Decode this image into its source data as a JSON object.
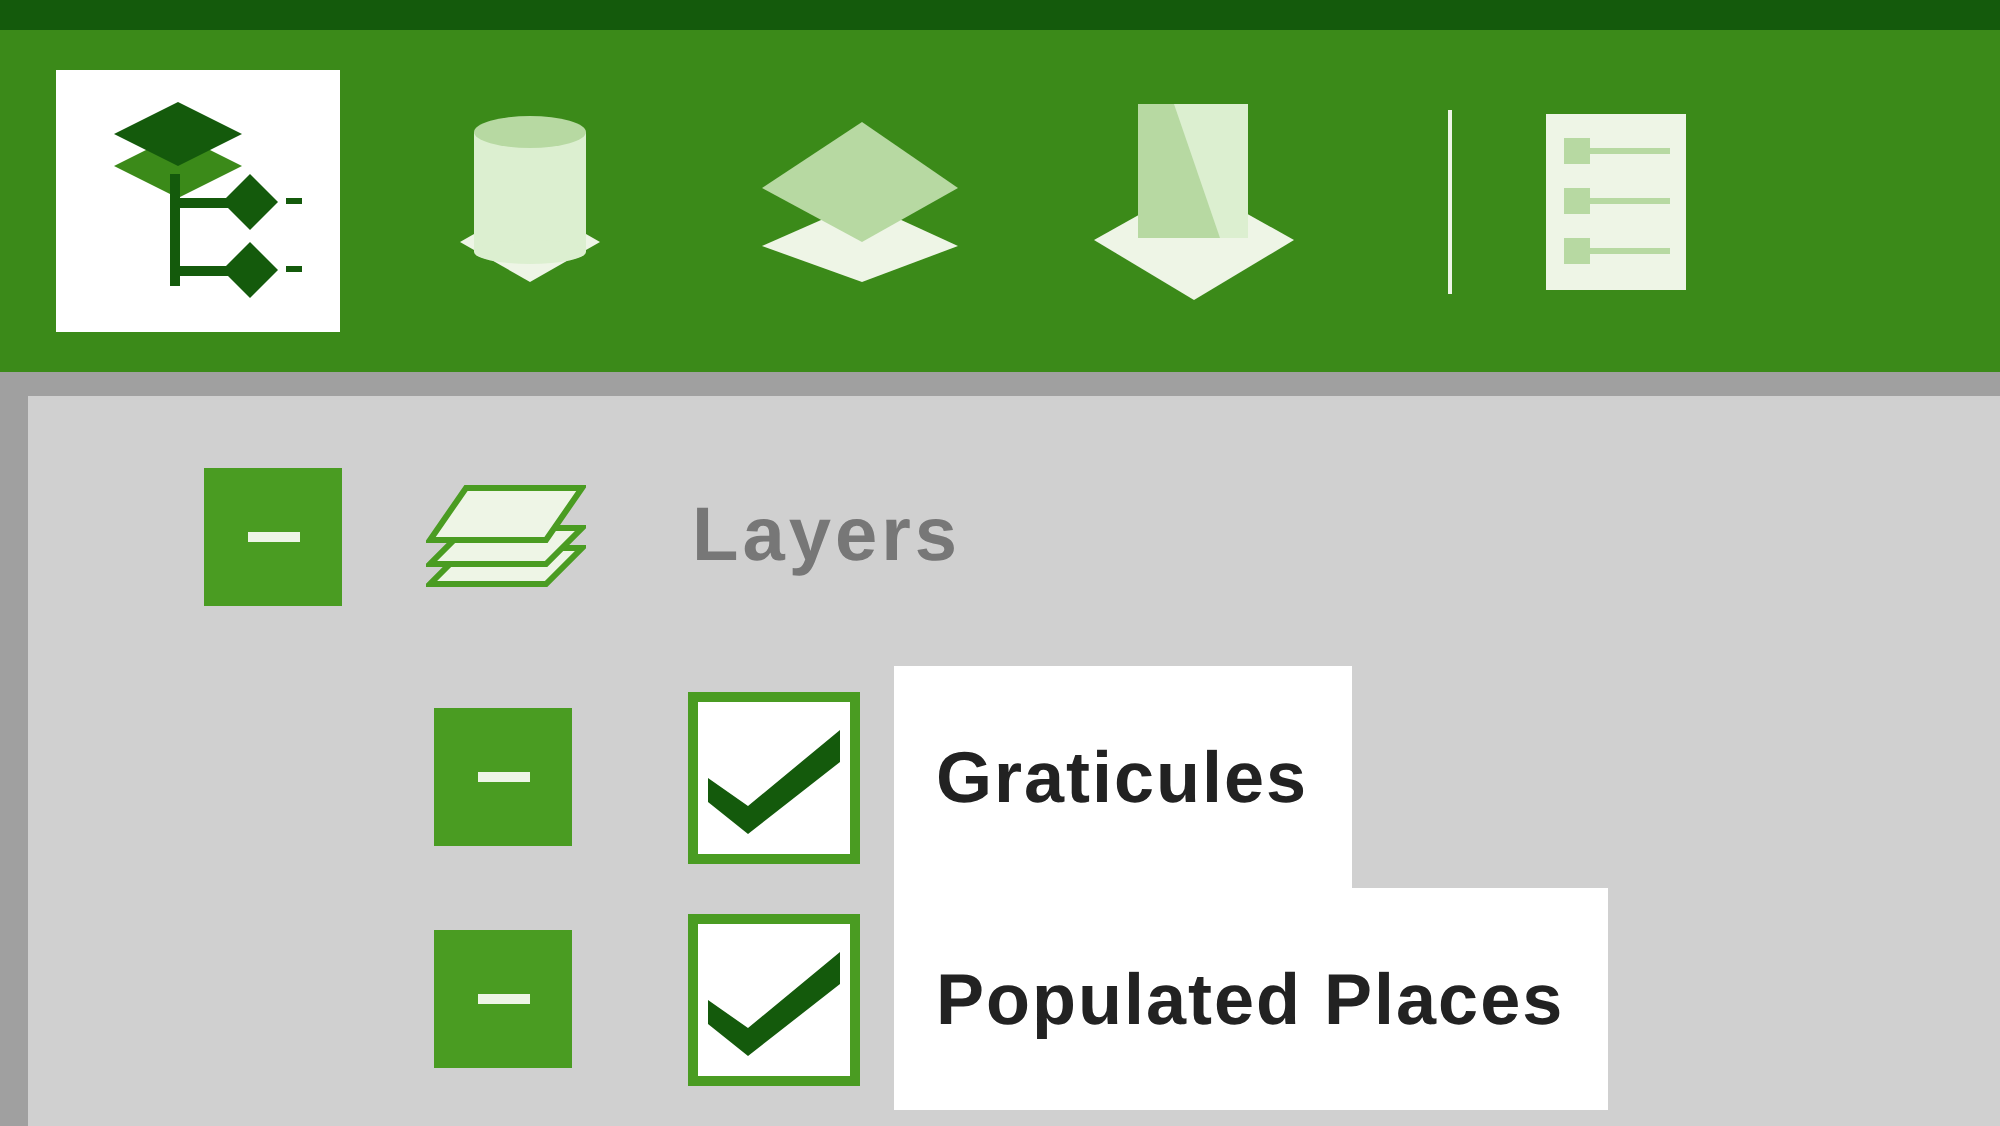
{
  "toolbar": {
    "groups": [
      [
        {
          "kind": "tree",
          "selected": true
        },
        {
          "kind": "database",
          "selected": false
        },
        {
          "kind": "layers",
          "selected": false
        },
        {
          "kind": "import",
          "selected": false
        }
      ],
      [
        {
          "kind": "list",
          "selected": false
        }
      ]
    ]
  },
  "tree": {
    "label": "Layers",
    "expanded": true,
    "children": [
      {
        "label": "Graticules",
        "expanded": true,
        "checked": true
      },
      {
        "label": "Populated Places",
        "expanded": true,
        "checked": true
      }
    ]
  }
}
